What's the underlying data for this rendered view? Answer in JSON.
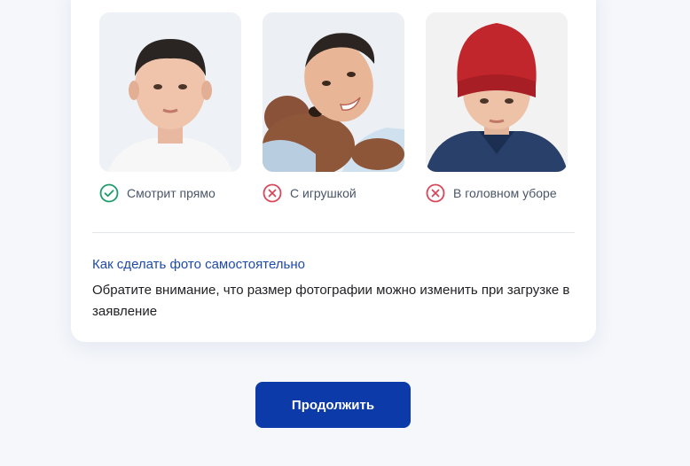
{
  "examples": [
    {
      "image": "child-looking-straight-photo",
      "status": "ok",
      "label": "Смотрит прямо"
    },
    {
      "image": "child-with-toy-photo",
      "status": "bad",
      "label": "С игрушкой"
    },
    {
      "image": "child-in-hat-photo",
      "status": "bad",
      "label": "В головном уборе"
    }
  ],
  "help": {
    "link": "Как сделать фото самостоятельно",
    "note": "Обратите внимание, что размер фотографии можно изменить при загрузке в заявление"
  },
  "actions": {
    "continue_label": "Продолжить"
  },
  "colors": {
    "ok": "#1d9b6c",
    "bad": "#d8475a",
    "link": "#1e4aa8",
    "primary_button": "#0d3aa9",
    "background": "#f5f7fb"
  }
}
